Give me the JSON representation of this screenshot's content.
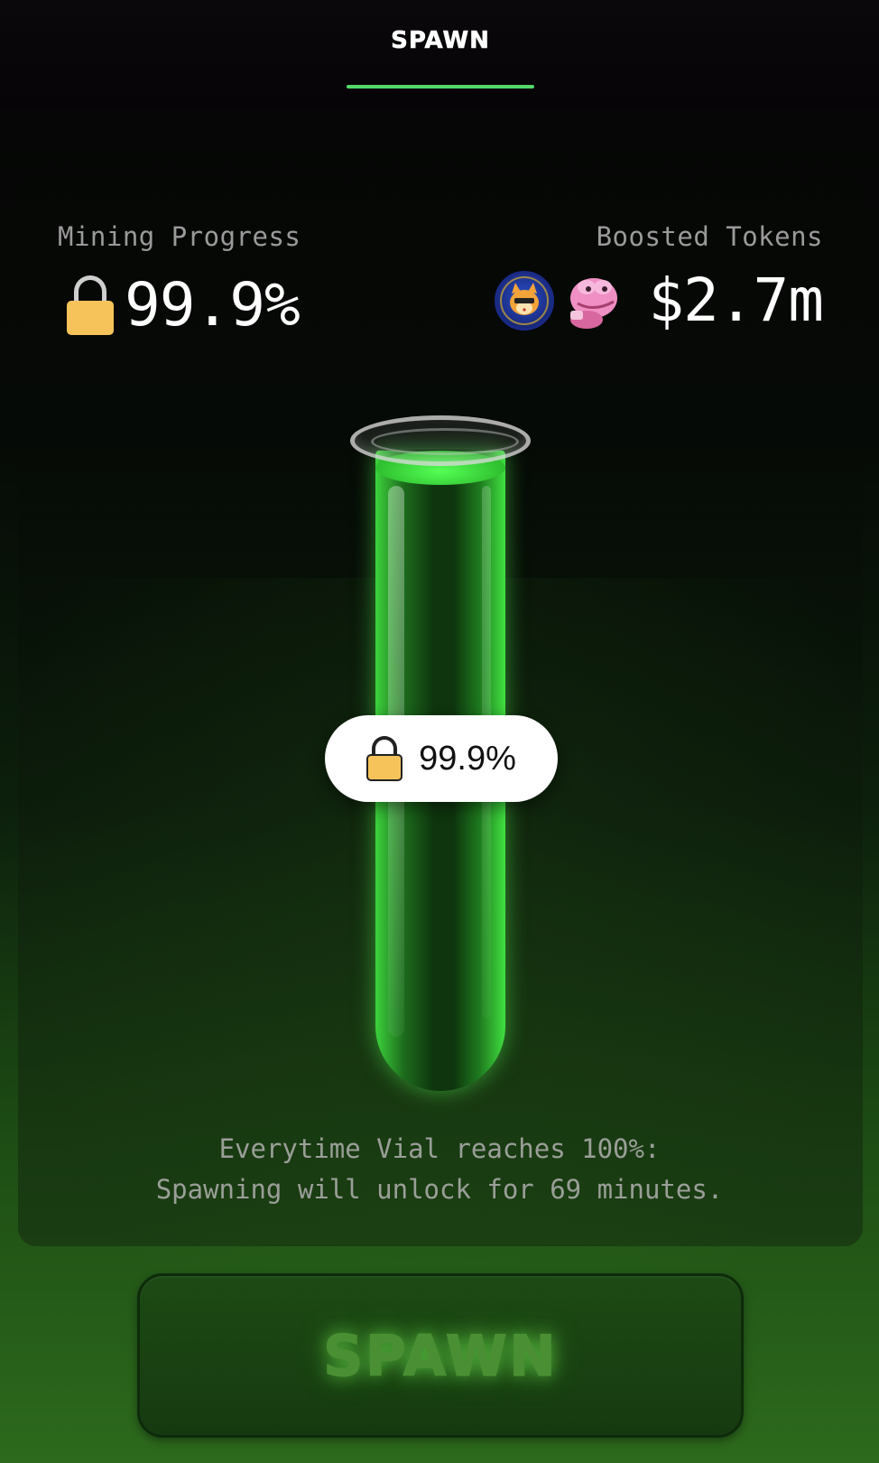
{
  "header": {
    "active_tab": "SPAWN",
    "accent_color": "#52d86a"
  },
  "stats": {
    "mining_progress_label": "Mining Progress",
    "mining_progress_value": "99.9%",
    "boosted_tokens_label": "Boosted Tokens",
    "boosted_tokens_value": "$2.7m",
    "tokens": [
      {
        "icon": "cat-token-icon"
      },
      {
        "icon": "pepe-token-icon"
      }
    ]
  },
  "vial": {
    "progress_label": "99.9%",
    "fill_fraction": 0.999,
    "liquid_color": "#3cd33c"
  },
  "info": {
    "line1": "Everytime Vial reaches 100%:",
    "line2": "Spawning will unlock for 69 minutes."
  },
  "spawn_button": {
    "label": "SPAWN",
    "enabled": false
  }
}
